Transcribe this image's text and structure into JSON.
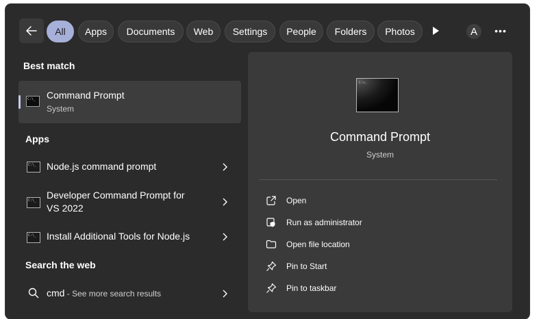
{
  "filters": {
    "back_icon": "arrow-left-icon",
    "items": [
      {
        "label": "All",
        "active": true
      },
      {
        "label": "Apps"
      },
      {
        "label": "Documents"
      },
      {
        "label": "Web"
      },
      {
        "label": "Settings"
      },
      {
        "label": "People"
      },
      {
        "label": "Folders"
      },
      {
        "label": "Photos"
      }
    ],
    "play_icon": "play-icon",
    "avatar_letter": "A",
    "more_icon": "more-icon",
    "more_glyph": "•••"
  },
  "best_match": {
    "heading": "Best match",
    "title": "Command Prompt",
    "subtitle": "System",
    "icon": "cmd-icon"
  },
  "apps": {
    "heading": "Apps",
    "items": [
      {
        "title": "Node.js command prompt",
        "icon": "cmd-icon"
      },
      {
        "title_line1": "Developer Command Prompt for",
        "title_line2": "VS 2022",
        "icon": "cmd-icon"
      },
      {
        "title": "Install Additional Tools for Node.js",
        "icon": "cmd-icon"
      }
    ]
  },
  "web": {
    "heading": "Search the web",
    "query": "cmd",
    "suffix": " - See more search results",
    "icon": "search-icon"
  },
  "detail": {
    "title": "Command Prompt",
    "subtitle": "System",
    "icon_prompt": "C:\\>_",
    "actions": [
      {
        "label": "Open",
        "icon": "open-external-icon"
      },
      {
        "label": "Run as administrator",
        "icon": "shield-icon"
      },
      {
        "label": "Open file location",
        "icon": "folder-icon"
      },
      {
        "label": "Pin to Start",
        "icon": "pin-icon"
      },
      {
        "label": "Pin to taskbar",
        "icon": "pin-icon"
      }
    ]
  },
  "colors": {
    "window_bg": "#2b2b2b",
    "panel_bg": "#3a3a3a",
    "active_filter": "#a7b0d9"
  }
}
